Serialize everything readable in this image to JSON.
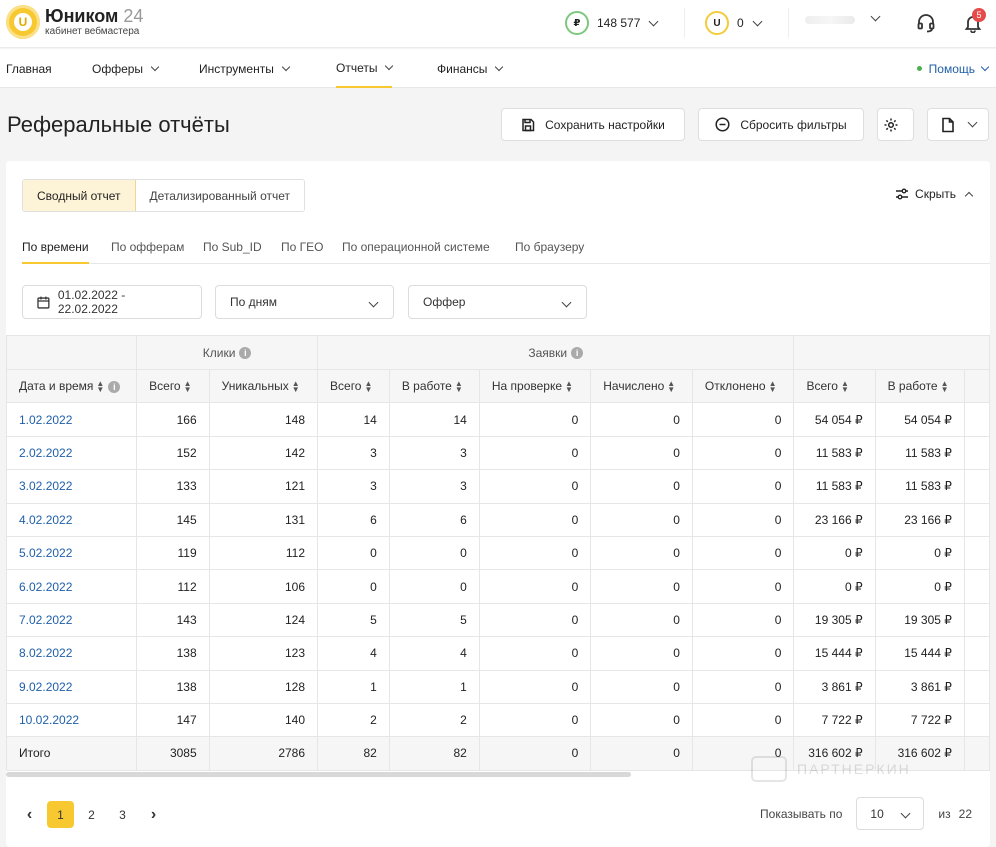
{
  "app": {
    "name": "Юником",
    "name_suffix": "24",
    "subtitle": "кабинет вебмастера"
  },
  "header": {
    "balance_rub": "148 577",
    "currency_symbol": "₽",
    "balance_u": "0",
    "u_symbol": "U",
    "notifications_count": "5"
  },
  "nav": {
    "items": [
      {
        "label": "Главная"
      },
      {
        "label": "Офферы"
      },
      {
        "label": "Инструменты"
      },
      {
        "label": "Отчеты"
      },
      {
        "label": "Финансы"
      }
    ],
    "help_label": "Помощь"
  },
  "page": {
    "title": "Реферальные отчёты",
    "save_label": "Сохранить настройки",
    "reset_label": "Сбросить фильтры"
  },
  "report": {
    "view_tabs": [
      "Сводный отчет",
      "Детализированный отчет"
    ],
    "hide_label": "Скрыть",
    "sub_tabs": [
      "По времени",
      "По офферам",
      "По Sub_ID",
      "По ГЕО",
      "По операционной системе",
      "По браузеру"
    ],
    "filters": {
      "date_range": "01.02.2022 - 22.02.2022",
      "grouping": "По дням",
      "offer_placeholder": "Оффер"
    }
  },
  "table": {
    "groups": {
      "clicks": "Клики",
      "leads": "Заявки"
    },
    "columns": [
      "Дата и время",
      "Всего",
      "Уникальных",
      "Всего",
      "В работе",
      "На проверке",
      "Начислено",
      "Отклонено",
      "Всего",
      "В работе"
    ],
    "rows": [
      [
        "1.02.2022",
        "166",
        "148",
        "14",
        "14",
        "0",
        "0",
        "0",
        "54 054 ₽",
        "54 054 ₽"
      ],
      [
        "2.02.2022",
        "152",
        "142",
        "3",
        "3",
        "0",
        "0",
        "0",
        "11 583 ₽",
        "11 583 ₽"
      ],
      [
        "3.02.2022",
        "133",
        "121",
        "3",
        "3",
        "0",
        "0",
        "0",
        "11 583 ₽",
        "11 583 ₽"
      ],
      [
        "4.02.2022",
        "145",
        "131",
        "6",
        "6",
        "0",
        "0",
        "0",
        "23 166 ₽",
        "23 166 ₽"
      ],
      [
        "5.02.2022",
        "119",
        "112",
        "0",
        "0",
        "0",
        "0",
        "0",
        "0 ₽",
        "0 ₽"
      ],
      [
        "6.02.2022",
        "112",
        "106",
        "0",
        "0",
        "0",
        "0",
        "0",
        "0 ₽",
        "0 ₽"
      ],
      [
        "7.02.2022",
        "143",
        "124",
        "5",
        "5",
        "0",
        "0",
        "0",
        "19 305 ₽",
        "19 305 ₽"
      ],
      [
        "8.02.2022",
        "138",
        "123",
        "4",
        "4",
        "0",
        "0",
        "0",
        "15 444 ₽",
        "15 444 ₽"
      ],
      [
        "9.02.2022",
        "138",
        "128",
        "1",
        "1",
        "0",
        "0",
        "0",
        "3 861 ₽",
        "3 861 ₽"
      ],
      [
        "10.02.2022",
        "147",
        "140",
        "2",
        "2",
        "0",
        "0",
        "0",
        "7 722 ₽",
        "7 722 ₽"
      ]
    ],
    "total": [
      "Итого",
      "3085",
      "2786",
      "82",
      "82",
      "0",
      "0",
      "0",
      "316 602 ₽",
      "316 602 ₽"
    ]
  },
  "pagination": {
    "pages": [
      "1",
      "2",
      "3"
    ],
    "current": "1",
    "per_page_label": "Показывать по",
    "per_page": "10",
    "of_label": "из",
    "total": "22"
  },
  "watermark": "ПАРТНЕРКИН",
  "colors": {
    "accent": "#f7c82f",
    "link": "#1f5fa8",
    "badge": "#e54b4b"
  }
}
